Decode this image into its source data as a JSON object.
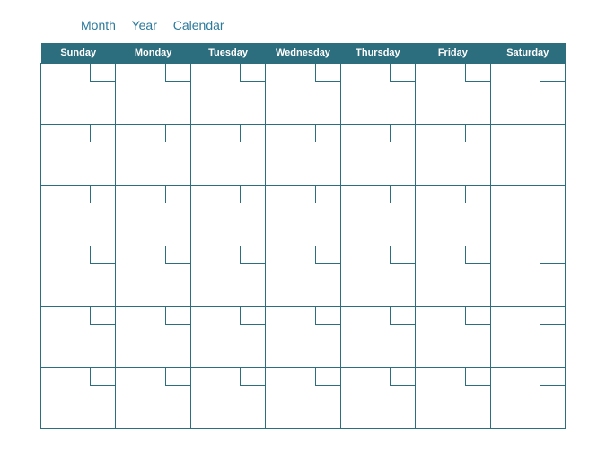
{
  "title": {
    "month": "Month",
    "year": "Year",
    "label": "Calendar"
  },
  "days": {
    "sunday": "Sunday",
    "monday": "Monday",
    "tuesday": "Tuesday",
    "wednesday": "Wednesday",
    "thursday": "Thursday",
    "friday": "Friday",
    "saturday": "Saturday"
  },
  "grid": {
    "rows": 6,
    "cols": 7
  },
  "colors": {
    "header_bg": "#2c6e7e",
    "border": "#2c6e7e",
    "title_text": "#2b7a9b"
  }
}
